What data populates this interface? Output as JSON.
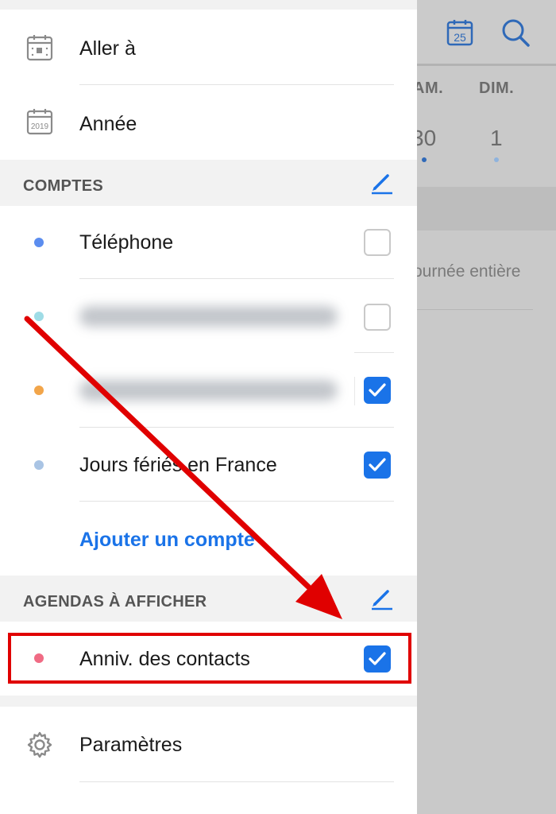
{
  "background_calendar": {
    "weekdays": [
      "AM.",
      "DIM."
    ],
    "dates": [
      "30",
      "1"
    ],
    "calendar_icon_day": "25",
    "allday_text": "ournée entière"
  },
  "menu": {
    "goto_label": "Aller à",
    "year_label": "Année",
    "year_icon_text": "2019"
  },
  "accounts": {
    "section_title": "COMPTES",
    "items": [
      {
        "label": "Téléphone",
        "color": "#5b8def",
        "checked": false
      },
      {
        "label": "",
        "color": "#9fdce6",
        "checked": false
      },
      {
        "label": "",
        "color": "#f2a54a",
        "checked": true
      },
      {
        "label": "Jours fériés en France",
        "color": "#a9c4e4",
        "checked": true
      }
    ],
    "add_account_label": "Ajouter un compte"
  },
  "agendas": {
    "section_title": "AGENDAS À AFFICHER",
    "items": [
      {
        "label": "Anniv. des contacts",
        "color": "#f06b84",
        "checked": true
      }
    ]
  },
  "settings": {
    "label": "Paramètres"
  },
  "colors": {
    "accent": "#1a73e8",
    "annotation_red": "#e00000"
  }
}
